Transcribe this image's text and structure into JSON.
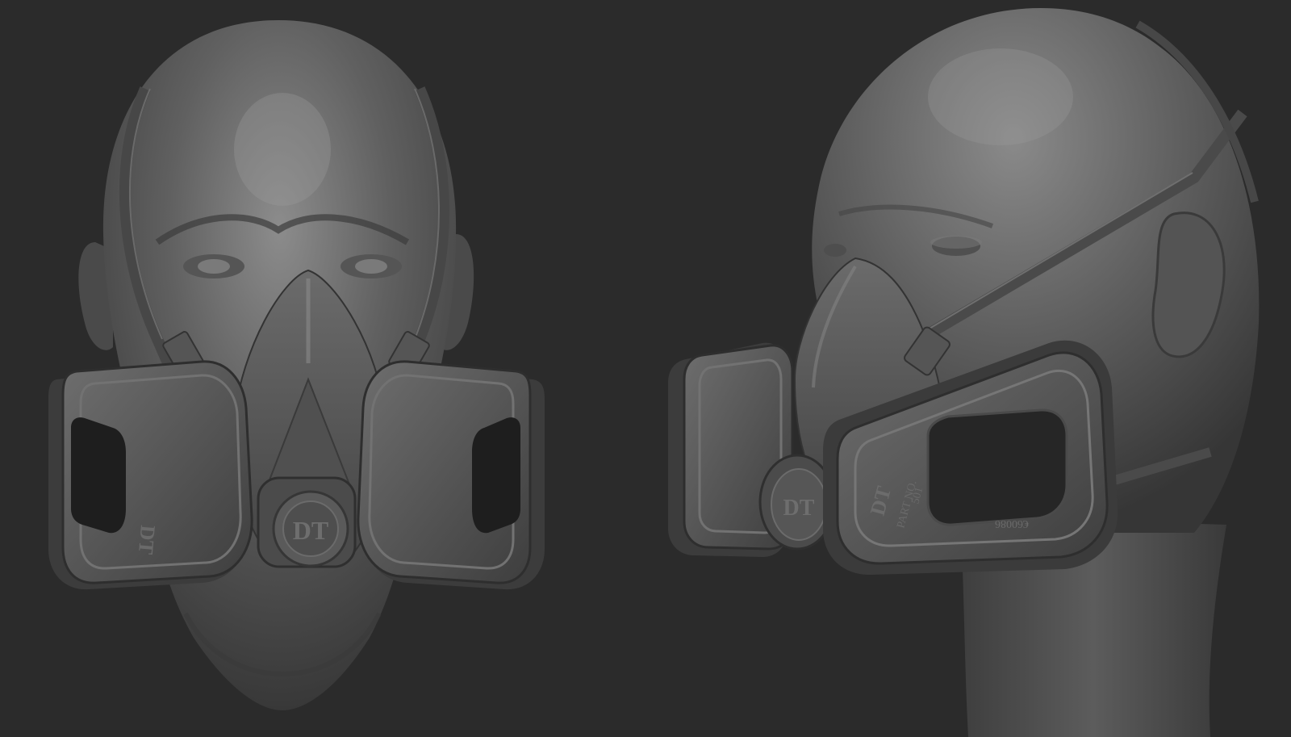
{
  "scene": {
    "background_color": "#2b2b2b",
    "material_color": "#5e5e5e",
    "render_style": "grayscale clay sculpt render",
    "views": [
      "front view",
      "three-quarter side view"
    ]
  },
  "markings": {
    "brand_logo_front": "DT",
    "brand_logo_side": "DT",
    "cartridge_logo": "DT",
    "part_no": "PART NO.",
    "part_number": "501",
    "cartridge_code": "€60086"
  },
  "colors": {
    "highlight": "#8a8a8a",
    "midtone": "#5a5a5a",
    "shadow": "#262626"
  }
}
